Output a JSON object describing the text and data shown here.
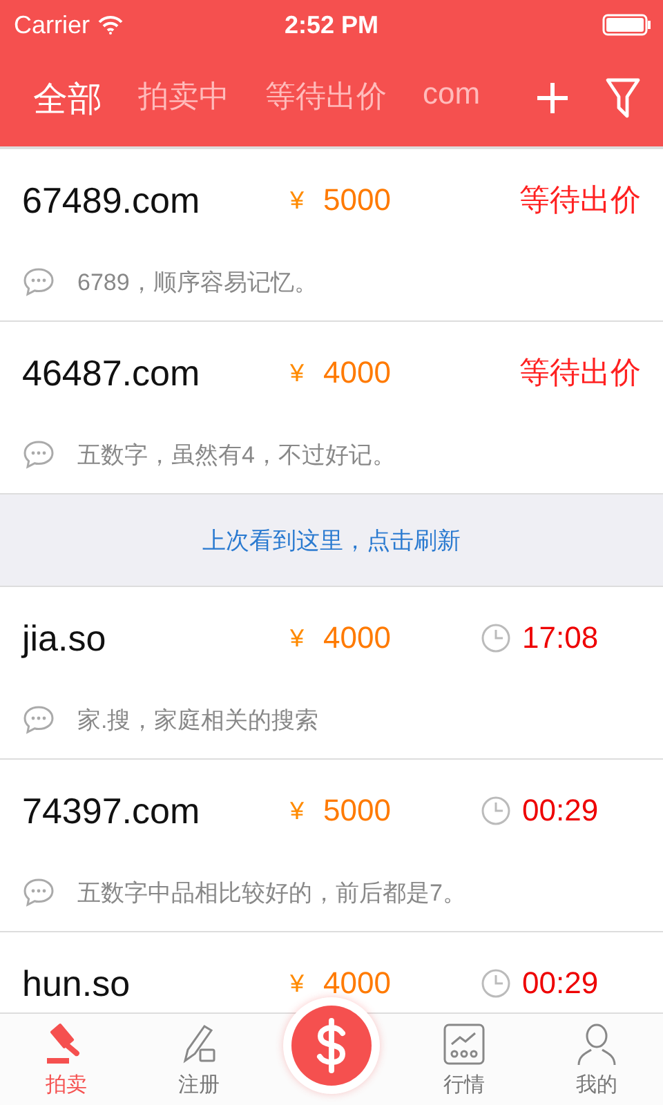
{
  "status_bar": {
    "carrier": "Carrier",
    "time": "2:52 PM"
  },
  "tabs": [
    {
      "label": "全部",
      "selected": true
    },
    {
      "label": "拍卖中",
      "selected": false
    },
    {
      "label": "等待出价",
      "selected": false
    },
    {
      "label": "com",
      "selected": false
    }
  ],
  "items": [
    {
      "domain": "67489.com",
      "currency": "¥",
      "price": "5000",
      "kind": "status",
      "status": "等待出价",
      "note": "6789，顺序容易记忆。"
    },
    {
      "domain": "46487.com",
      "currency": "¥",
      "price": "4000",
      "kind": "status",
      "status": "等待出价",
      "note": "五数字，虽然有4，不过好记。"
    },
    {
      "kind": "banner",
      "text": "上次看到这里，点击刷新"
    },
    {
      "domain": "jia.so",
      "currency": "¥",
      "price": "4000",
      "kind": "timer",
      "status": "17:08",
      "note": "家.搜，家庭相关的搜索"
    },
    {
      "domain": "74397.com",
      "currency": "¥",
      "price": "5000",
      "kind": "timer",
      "status": "00:29",
      "note": "五数字中品相比较好的，前后都是7。"
    },
    {
      "domain": "hun.so",
      "currency": "¥",
      "price": "4000",
      "kind": "timer",
      "status": "00:29"
    }
  ],
  "bottom_tabs": [
    {
      "label": "拍卖",
      "selected": true
    },
    {
      "label": "注册",
      "selected": false
    },
    {
      "kind": "center"
    },
    {
      "label": "行情",
      "selected": false
    },
    {
      "label": "我的",
      "selected": false
    }
  ]
}
